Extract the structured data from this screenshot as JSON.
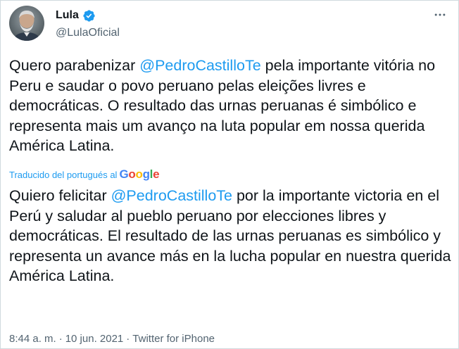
{
  "user": {
    "display_name": "Lula",
    "handle": "@LulaOficial",
    "verified_icon": "verified-badge-icon",
    "avatar_icon": "avatar"
  },
  "tweet": {
    "original": {
      "part1": "Quero parabenizar ",
      "mention": "@PedroCastilloTe",
      "part2": " pela importante vitória no Peru e saudar o povo peruano pelas eleições livres e democráticas. O resultado das urnas peruanas é simbólico e representa mais um avanço na luta popular em nossa querida América Latina."
    },
    "translation_note": {
      "label": "Traducido del portugués al",
      "provider": {
        "G": "G",
        "o1": "o",
        "o2": "o",
        "g": "g",
        "l": "l",
        "e": "e"
      }
    },
    "translated": {
      "part1": "Quiero felicitar ",
      "mention": "@PedroCastilloTe",
      "part2": " por la importante victoria en el Perú y saludar al pueblo peruano por elecciones libres y democráticas. El resultado de las urnas peruanas es simbólico y representa un avance más en la lucha popular en nuestra querida América Latina."
    },
    "meta": {
      "time": "8:44 a. m.",
      "separator1": "·",
      "date": "10 jun. 2021",
      "separator2": "·",
      "source": "Twitter for iPhone"
    }
  },
  "colors": {
    "accent": "#1d9bf0",
    "text": "#0f1419",
    "secondary": "#536471"
  },
  "icons": {
    "more": "more-options-icon"
  }
}
